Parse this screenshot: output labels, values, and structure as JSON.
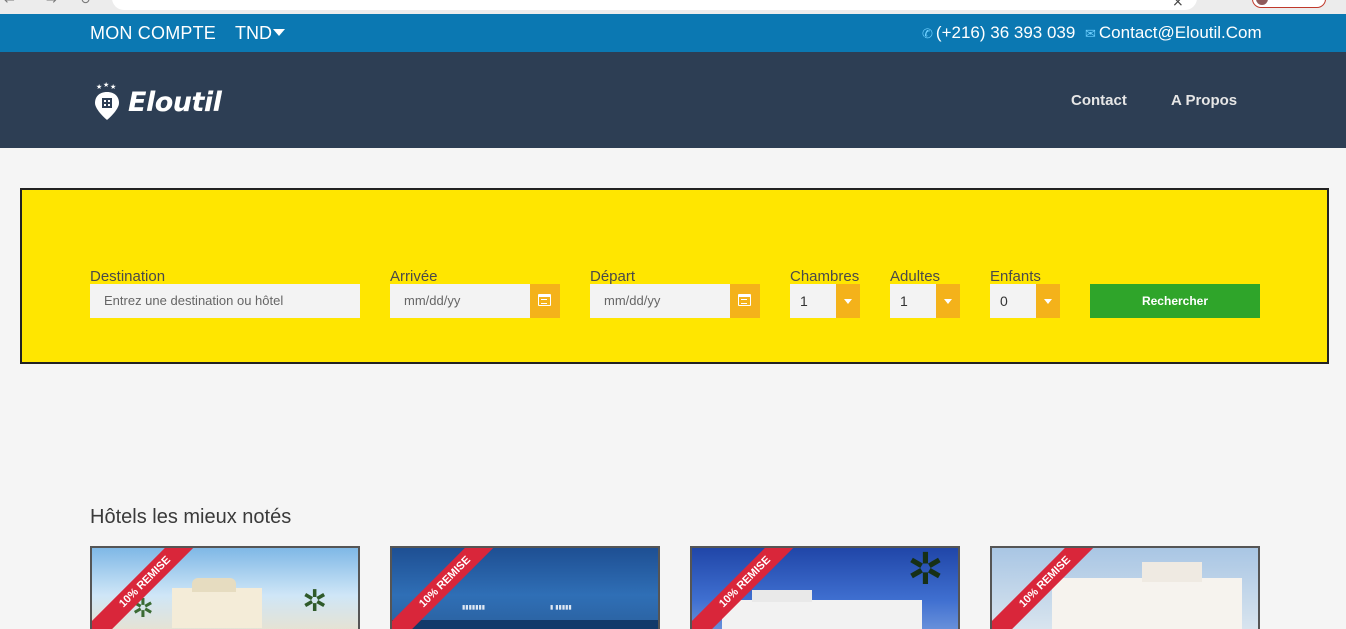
{
  "topbar": {
    "account": "MON COMPTE",
    "currency": "TND",
    "phone": "(+216) 36 393 039",
    "email": "Contact@Eloutil.Com"
  },
  "header": {
    "brand": "Eloutil",
    "nav": [
      "Contact",
      "A Propos"
    ]
  },
  "search": {
    "destination_label": "Destination",
    "destination_placeholder": "Entrez une destination ou hôtel",
    "arrival_label": "Arrivée",
    "arrival_placeholder": "mm/dd/yy",
    "departure_label": "Départ",
    "departure_placeholder": "mm/dd/yy",
    "rooms_label": "Chambres",
    "rooms_value": "1",
    "adults_label": "Adultes",
    "adults_value": "1",
    "children_label": "Enfants",
    "children_value": "0",
    "button": "Rechercher"
  },
  "section": {
    "title": "Hôtels les mieux notés",
    "cards": [
      {
        "badge": "10% REMISE"
      },
      {
        "badge": "10% REMISE"
      },
      {
        "badge": "10% REMISE"
      },
      {
        "badge": "10% REMISE"
      }
    ]
  },
  "colors": {
    "topbar": "#0b78b2",
    "header": "#2d3e54",
    "search_bg": "#ffe600",
    "addon": "#f4b21a",
    "button": "#2fa52a",
    "ribbon": "#d9263a"
  }
}
